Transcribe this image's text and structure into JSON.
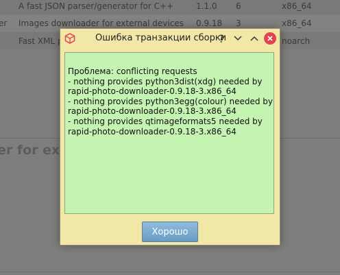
{
  "background": {
    "rows": [
      {
        "c0": "",
        "c1": "A fast JSON parser/generator for C++",
        "c2": "1.1.0",
        "c3": "6",
        "c4": "x86_64"
      },
      {
        "c0": "er",
        "c1": "Images downloader for external devices",
        "c2": "0.9.18",
        "c3": "3",
        "c4": "x86_64"
      },
      {
        "c0": "",
        "c1": "Fast XML p",
        "c2": "",
        "c3": "",
        "c4": "noarch"
      }
    ],
    "heading": "er for exte"
  },
  "dialog": {
    "title": "Ошибка транзакции сборки",
    "help_glyph": "?",
    "minimize_glyph": "⌄",
    "maximize_glyph": "⌃",
    "close_glyph": "✕",
    "message": "Проблема: conflicting requests\n- nothing provides python3dist(xdg) needed by\nrapid-photo-downloader-0.9.18-3.x86_64\n- nothing provides python3egg(colour) needed by\nrapid-photo-downloader-0.9.18-3.x86_64\n- nothing provides qtimageformats5 needed by\nrapid-photo-downloader-0.9.18-3.x86_64",
    "ok_label": "Хорошо"
  },
  "icons": {
    "app": "package-icon",
    "help": "help-icon",
    "minimize": "chevron-down-icon",
    "maximize": "chevron-up-icon",
    "close": "close-icon"
  },
  "colors": {
    "dialog_bg": "#f1e7a6",
    "message_bg": "#c5f3b1",
    "ok_button": "#7aa9cf",
    "close_button": "#e2444f",
    "app_icon": "#e64b5a"
  }
}
